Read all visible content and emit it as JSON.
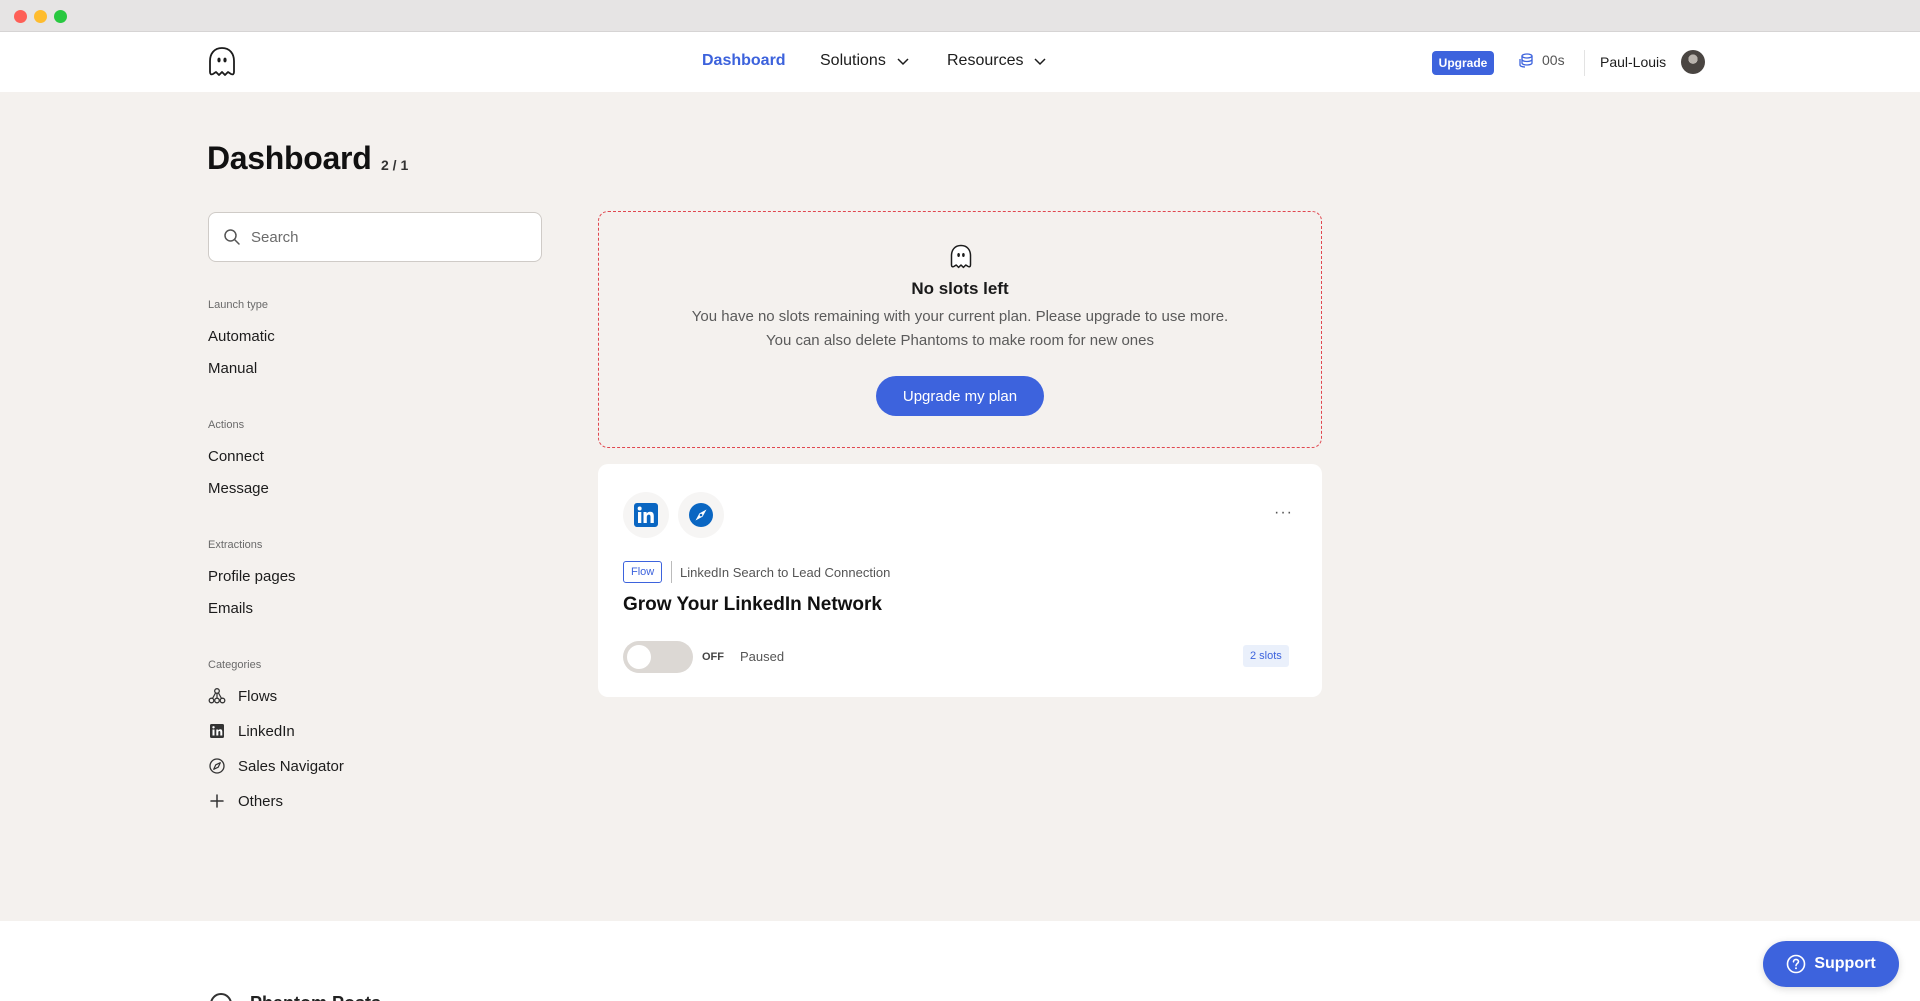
{
  "nav": {
    "dashboard": "Dashboard",
    "solutions": "Solutions",
    "resources": "Resources",
    "upgrade": "Upgrade",
    "time": "00s",
    "user": "Paul-Louis"
  },
  "page": {
    "title": "Dashboard",
    "slots": "2 / 1"
  },
  "sidebar": {
    "search_placeholder": "Search",
    "launch_type": {
      "heading": "Launch type",
      "items": [
        "Automatic",
        "Manual"
      ]
    },
    "actions": {
      "heading": "Actions",
      "items": [
        "Connect",
        "Message"
      ]
    },
    "extractions": {
      "heading": "Extractions",
      "items": [
        "Profile pages",
        "Emails"
      ]
    },
    "categories": {
      "heading": "Categories",
      "items": [
        {
          "label": "Flows",
          "icon": "flows-icon"
        },
        {
          "label": "LinkedIn",
          "icon": "linkedin-icon"
        },
        {
          "label": "Sales Navigator",
          "icon": "compass-icon"
        },
        {
          "label": "Others",
          "icon": "plus-icon"
        }
      ]
    }
  },
  "noslots": {
    "title": "No slots left",
    "line1": "You have no slots remaining with your current plan. Please upgrade to use more.",
    "line2": "You can also delete Phantoms to make room for new ones",
    "button": "Upgrade my plan",
    "accent": "#e0474f"
  },
  "card": {
    "tag": "Flow",
    "flow_name": "LinkedIn Search to Lead Connection",
    "title": "Grow Your LinkedIn Network",
    "toggle": "OFF",
    "status": "Paused",
    "slots": "2 slots",
    "more": "···"
  },
  "footer": {
    "text": "Phantom Posts"
  },
  "support": {
    "label": "Support"
  },
  "colors": {
    "primary": "#3d63dd",
    "linkedin": "#0a66c2",
    "background": "#f4f1ee"
  }
}
